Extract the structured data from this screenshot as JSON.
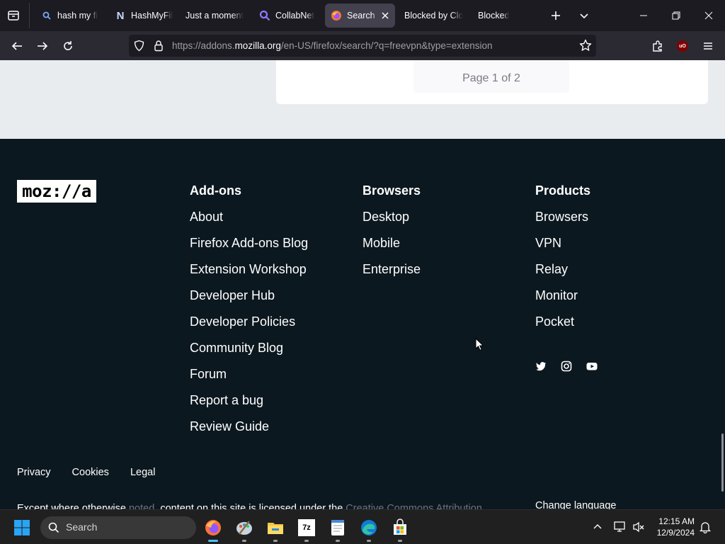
{
  "browser": {
    "tabs": [
      {
        "title": "hash my fi",
        "icon": "search-icon",
        "active": false
      },
      {
        "title": "HashMyFil",
        "icon": "notion-n-icon",
        "active": false
      },
      {
        "title": "Just a moment",
        "icon": "none",
        "active": false
      },
      {
        "title": "CollabNet",
        "icon": "search-icon",
        "active": false
      },
      {
        "title": "Search r",
        "icon": "firefox-icon",
        "active": true
      },
      {
        "title": "Blocked by Clo",
        "icon": "none",
        "active": false
      },
      {
        "title": "Blocked",
        "icon": "none",
        "active": false
      }
    ],
    "url_prefix": "https://addons.",
    "url_domain": "mozilla.org",
    "url_suffix": "/en-US/firefox/search/?q=freevpn&type=extension",
    "addon_badge": "uO"
  },
  "page": {
    "pagination": "Page 1 of 2"
  },
  "footer": {
    "logo_text": "moz://a",
    "columns": [
      {
        "heading": "Add-ons",
        "links": [
          "About",
          "Firefox Add-ons Blog",
          "Extension Workshop",
          "Developer Hub",
          "Developer Policies",
          "Community Blog",
          "Forum",
          "Report a bug",
          "Review Guide"
        ]
      },
      {
        "heading": "Browsers",
        "links": [
          "Desktop",
          "Mobile",
          "Enterprise"
        ]
      },
      {
        "heading": "Products",
        "links": [
          "Browsers",
          "VPN",
          "Relay",
          "Monitor",
          "Pocket"
        ]
      }
    ],
    "social": [
      "twitter-icon",
      "instagram-icon",
      "youtube-icon"
    ],
    "legal_links": [
      "Privacy",
      "Cookies",
      "Legal"
    ],
    "license_part1": "Except where otherwise ",
    "license_link1": "noted",
    "license_part2": ", content on this site is licensed under the ",
    "license_link2": "Creative Commons Attribution",
    "change_language": "Change language"
  },
  "taskbar": {
    "search_placeholder": "Search",
    "apps": [
      "firefox-icon",
      "paint-icon",
      "file-explorer-icon",
      "7zip-icon",
      "notepad-icon",
      "edge-icon",
      "store-icon"
    ],
    "time": "12:15 AM",
    "date": "12/9/2024"
  },
  "colors": {
    "footer_bg": "#0c181f",
    "tab_strip_bg": "#1c1b22",
    "toolbar_bg": "#2b2a33",
    "accent": "#4cc2ff"
  }
}
